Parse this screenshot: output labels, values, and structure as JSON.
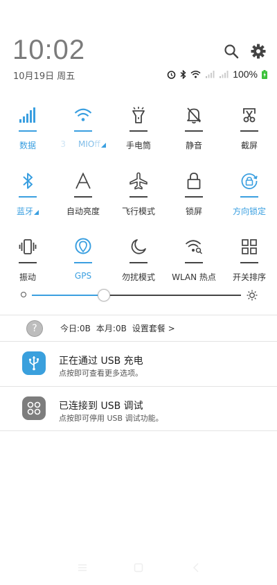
{
  "header": {
    "time": "10:02",
    "date": "10月19日 周五"
  },
  "status": {
    "battery": "100%"
  },
  "tiles": [
    {
      "label": "数据",
      "on": true
    },
    {
      "label": "MIO",
      "on": true
    },
    {
      "label": "手电筒",
      "on": false
    },
    {
      "label": "静音",
      "on": false
    },
    {
      "label": "截屏",
      "on": false
    },
    {
      "label": "蓝牙",
      "on": true
    },
    {
      "label": "自动亮度",
      "on": false
    },
    {
      "label": "飞行模式",
      "on": false
    },
    {
      "label": "锁屏",
      "on": false
    },
    {
      "label": "方向锁定",
      "on": true
    },
    {
      "label": "振动",
      "on": false
    },
    {
      "label": "GPS",
      "on": true
    },
    {
      "label": "勿扰模式",
      "on": false
    },
    {
      "label": "WLAN 热点",
      "on": false
    },
    {
      "label": "开关排序",
      "on": false
    }
  ],
  "brightness": {
    "level": 0.34
  },
  "data_usage": {
    "today": "今日:0B",
    "month": "本月:0B",
    "settings": "设置套餐 >"
  },
  "notifications": [
    {
      "title": "正在通过 USB 充电",
      "subtitle": "点按即可查看更多选项。"
    },
    {
      "title": "已连接到 USB 调试",
      "subtitle": "点按即可停用 USB 调试功能。"
    }
  ],
  "colors": {
    "accent": "#3a9fe0",
    "usb_blue": "#3aa0dd",
    "debug_gray": "#7d7d7d",
    "battery_green": "#3cc13b"
  }
}
